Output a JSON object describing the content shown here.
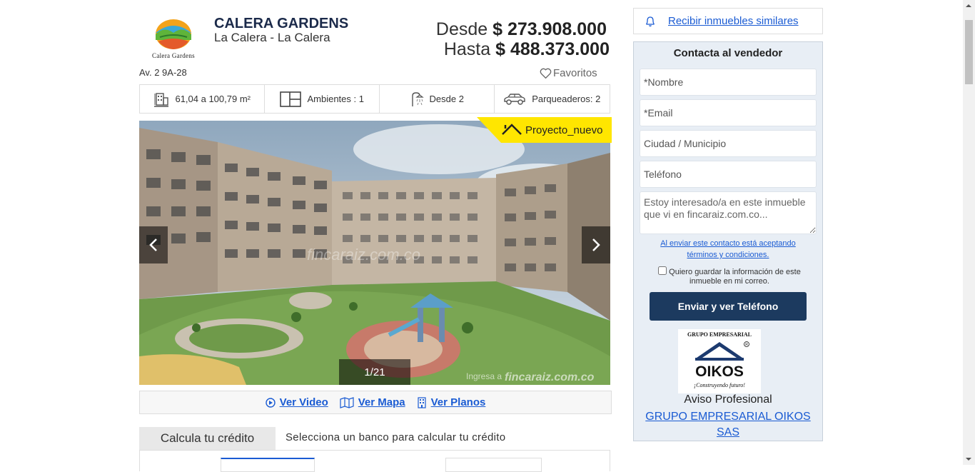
{
  "project": {
    "name": "CALERA GARDENS",
    "location": "La Calera - La Calera",
    "logo_text": "Calera Gardens",
    "address": "Av. 2 9A-28",
    "price_from_label": "Desde",
    "price_from": "$ 273.908.000",
    "price_to_label": "Hasta",
    "price_to": "$ 488.373.000",
    "favorites_label": "Favoritos"
  },
  "features": [
    {
      "icon": "area-icon",
      "label": "61,04 a 100,79 m²"
    },
    {
      "icon": "rooms-icon",
      "label": "Ambientes : 1"
    },
    {
      "icon": "shower-icon",
      "label": "Desde  2"
    },
    {
      "icon": "car-icon",
      "label": "Parqueaderos: 2"
    }
  ],
  "gallery": {
    "badge": "Proyecto_nuevo",
    "counter": "1/21",
    "watermark": "fincaraiz.com.co",
    "watermark_small": "Ingresa a"
  },
  "media_links": {
    "video": "Ver Video",
    "map": "Ver Mapa",
    "plans": "Ver Planos"
  },
  "credit": {
    "tab": "Calcula tu crédito",
    "prompt": "Selecciona un banco para calcular tu crédito"
  },
  "sidebar": {
    "alert_link": "Recibir inmuebles similares",
    "contact_title": "Contacta al vendedor",
    "fields": {
      "name": "*Nombre",
      "email": "*Email",
      "city": "Ciudad / Municipio",
      "phone": "Teléfono",
      "message": "Estoy interesado/a en este inmueble que vi en fincaraiz.com.co..."
    },
    "terms": "Al enviar este contacto está aceptando términos y condiciones.",
    "save_info": "Quiero guardar la información de este inmueble en mi correo.",
    "send_button": "Enviar y ver Teléfono",
    "seller_logo": {
      "top": "GRUPO EMPRESARIAL",
      "name": "OIKOS",
      "slogan": "¡Construyendo futuro!"
    },
    "seller_type": "Aviso Profesional",
    "seller_name": "GRUPO EMPRESARIAL OIKOS SAS"
  },
  "colors": {
    "brand_navy": "#1c3a5f",
    "link_blue": "#1a5bd3",
    "badge_yellow": "#ffe600"
  }
}
